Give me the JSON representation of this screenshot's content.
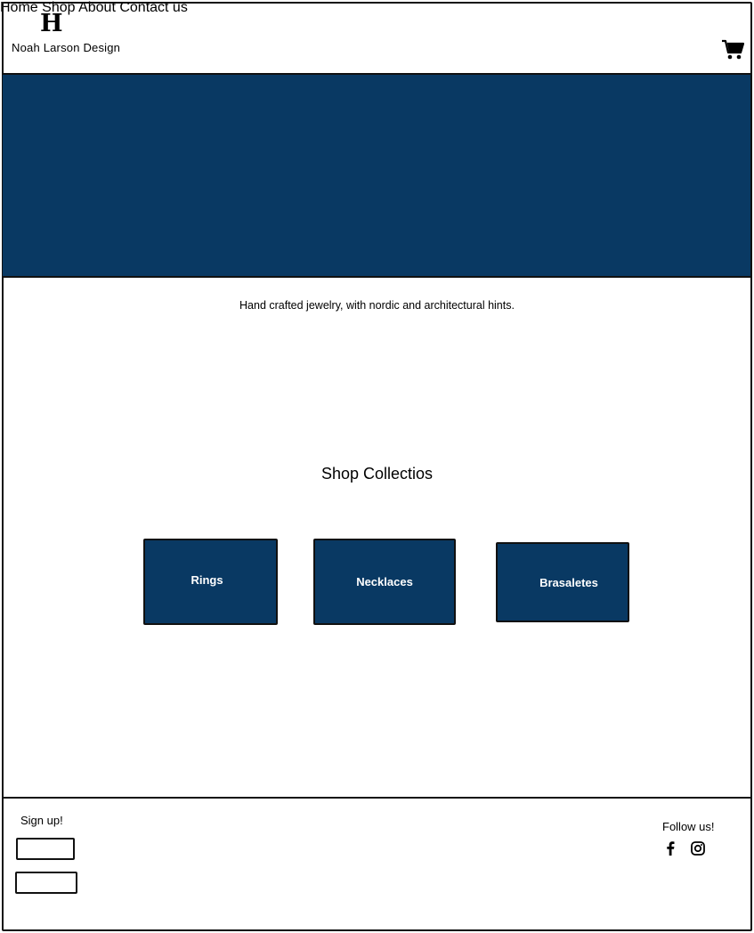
{
  "header": {
    "logo_mark": "H",
    "brand_name": "Noah Larson Design",
    "nav": [
      {
        "label": "Home"
      },
      {
        "label": "Shop"
      },
      {
        "label": "About"
      },
      {
        "label": "Contact us"
      }
    ],
    "cart_icon": "shopping-cart-icon"
  },
  "hero": {
    "color": "#093963"
  },
  "intro": {
    "tagline": "Hand crafted jewelry, with nordic and architectural hints."
  },
  "collections": {
    "title": "Shop Collectios",
    "tile_color": "#093963",
    "items": [
      {
        "label": "Rings"
      },
      {
        "label": "Necklaces"
      },
      {
        "label": "Brasaletes"
      }
    ]
  },
  "footer": {
    "signup_label": "Sign up!",
    "follow_label": "Follow us!",
    "social_icons": [
      "facebook-icon",
      "instagram-icon"
    ]
  }
}
